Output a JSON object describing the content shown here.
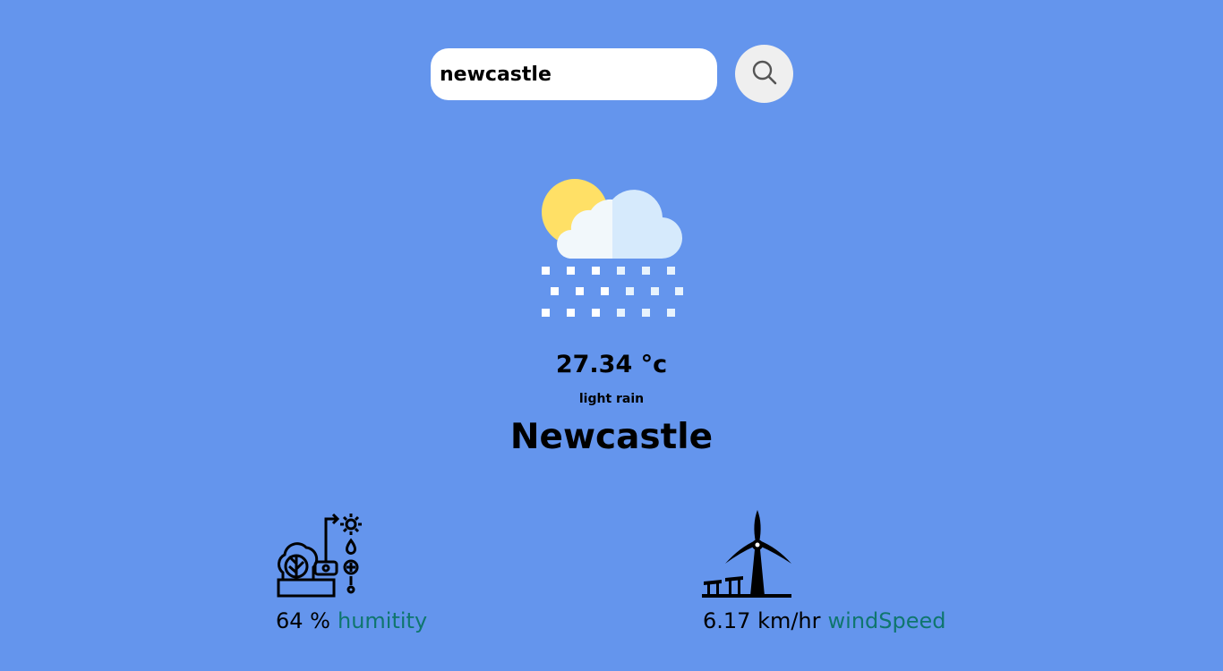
{
  "search": {
    "value": "newcastle"
  },
  "search_button": {
    "icon": "search-icon"
  },
  "weather": {
    "icon": "sun-cloud-snow-icon",
    "temperature": "27.34 °c",
    "description": "light rain",
    "city": "Newcastle"
  },
  "humidity": {
    "icon": "plant-irrigation-icon",
    "value": "64 %",
    "label": "humitity"
  },
  "wind": {
    "icon": "wind-turbine-icon",
    "value": "6.17 km/hr",
    "label": "windSpeed"
  },
  "colors": {
    "background": "#6495ed",
    "label_accent": "#0f766e",
    "search_field": "#ffffff",
    "search_button": "#efefef"
  }
}
